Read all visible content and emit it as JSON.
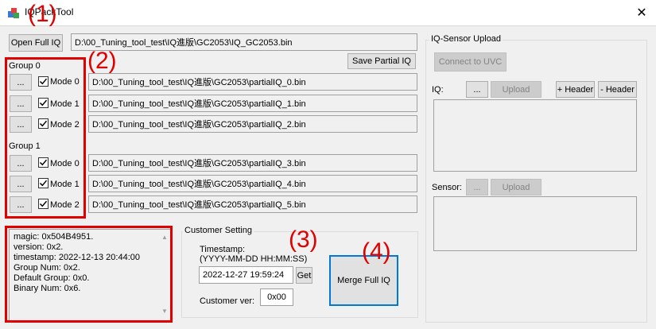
{
  "window": {
    "title": "IQPackTool",
    "close_glyph": "✕"
  },
  "toolbar": {
    "open_label": "Open Full IQ",
    "full_path": "D:\\00_Tuning_tool_test\\IQ進版\\GC2053\\IQ_GC2053.bin",
    "save_partial_label": "Save Partial IQ"
  },
  "groups": [
    {
      "label": "Group 0",
      "modes": [
        {
          "browse": "...",
          "label": "Mode 0",
          "checked": true,
          "path": "D:\\00_Tuning_tool_test\\IQ進版\\GC2053\\partialIQ_0.bin"
        },
        {
          "browse": "...",
          "label": "Mode 1",
          "checked": true,
          "path": "D:\\00_Tuning_tool_test\\IQ進版\\GC2053\\partialIQ_1.bin"
        },
        {
          "browse": "...",
          "label": "Mode 2",
          "checked": true,
          "path": "D:\\00_Tuning_tool_test\\IQ進版\\GC2053\\partialIQ_2.bin"
        }
      ]
    },
    {
      "label": "Group 1",
      "modes": [
        {
          "browse": "...",
          "label": "Mode 0",
          "checked": true,
          "path": "D:\\00_Tuning_tool_test\\IQ進版\\GC2053\\partialIQ_3.bin"
        },
        {
          "browse": "...",
          "label": "Mode 1",
          "checked": true,
          "path": "D:\\00_Tuning_tool_test\\IQ進版\\GC2053\\partialIQ_4.bin"
        },
        {
          "browse": "...",
          "label": "Mode 2",
          "checked": true,
          "path": "D:\\00_Tuning_tool_test\\IQ進版\\GC2053\\partialIQ_5.bin"
        }
      ]
    }
  ],
  "info": {
    "lines": [
      "magic: 0x504B4951.",
      "version: 0x2.",
      "timestamp: 2022-12-13 20:44:00",
      "Group Num: 0x2.",
      "Default Group: 0x0.",
      "Binary Num: 0x6."
    ]
  },
  "customer": {
    "group_title": "Customer Setting",
    "timestamp_label": "Timestamp:",
    "timestamp_format": "(YYYY-MM-DD HH:MM:SS)",
    "timestamp_value": "2022-12-27 19:59:24",
    "get_label": "Get",
    "ver_label": "Customer ver:",
    "ver_value": "0x00",
    "merge_label": "Merge Full IQ"
  },
  "sensor_upload": {
    "group_title": "IQ-Sensor Upload",
    "connect_label": "Connect to UVC",
    "iq_label": "IQ:",
    "iq_browse": "...",
    "iq_upload": "Upload",
    "add_header": "+ Header",
    "remove_header": "- Header",
    "sensor_label": "Sensor:",
    "sensor_browse": "...",
    "sensor_upload": "Upload"
  },
  "annotations": [
    "(1)",
    "(2)",
    "(3)",
    "(4)"
  ],
  "colors": {
    "annotation": "#e00000",
    "focus": "#0078d7"
  }
}
